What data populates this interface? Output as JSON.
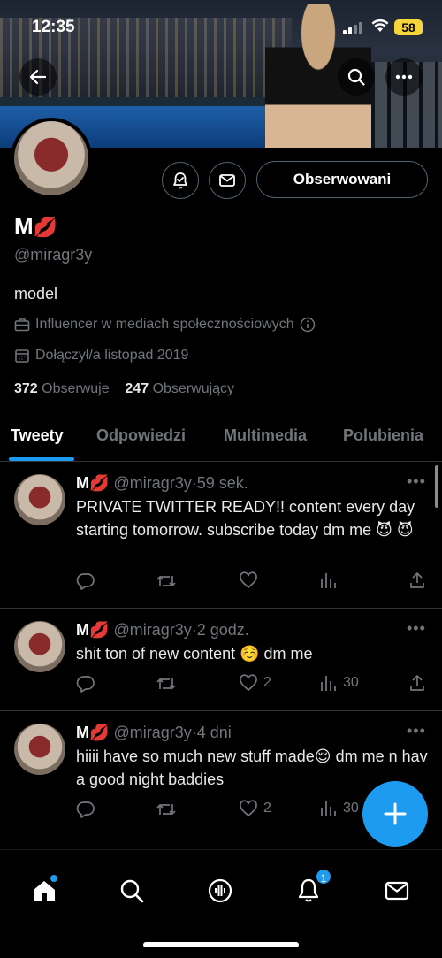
{
  "status_bar": {
    "time": "12:35",
    "battery": "58"
  },
  "profile": {
    "name": "M",
    "name_emoji": "💋",
    "handle": "@miragr3y",
    "bio": "model",
    "category": "Influencer w mediach społecznościowych",
    "joined": "Dołączył/a listopad 2019",
    "following_count": "372",
    "following_label": "Obserwuje",
    "followers_count": "247",
    "followers_label": "Obserwujący",
    "follow_button": "Obserwowani"
  },
  "tabs": [
    {
      "label": "Tweety",
      "active": true
    },
    {
      "label": "Odpowiedzi"
    },
    {
      "label": "Multimedia"
    },
    {
      "label": "Polubienia"
    }
  ],
  "tweets": [
    {
      "name": "M",
      "emoji": "💋",
      "handle": "@miragr3y",
      "time": "59 sek.",
      "text": "PRIVATE TWITTER READY!! content every day starting tomorrow. subscribe today dm me 😈 😈",
      "likes": "",
      "views": ""
    },
    {
      "name": "M",
      "emoji": "💋",
      "handle": "@miragr3y",
      "time": "2 godz.",
      "text": "shit ton of new content ☺️ dm me",
      "likes": "2",
      "views": "30"
    },
    {
      "name": "M",
      "emoji": "💋",
      "handle": "@miragr3y",
      "time": "4 dni",
      "text": "hiiii have so much new stuff made😌 dm me n hav a good night baddies",
      "likes": "2",
      "views": "30"
    }
  ],
  "nav": {
    "notifications_badge": "1"
  },
  "colors": {
    "accent": "#1d9bf0",
    "background": "#000000",
    "muted": "#71767b"
  }
}
